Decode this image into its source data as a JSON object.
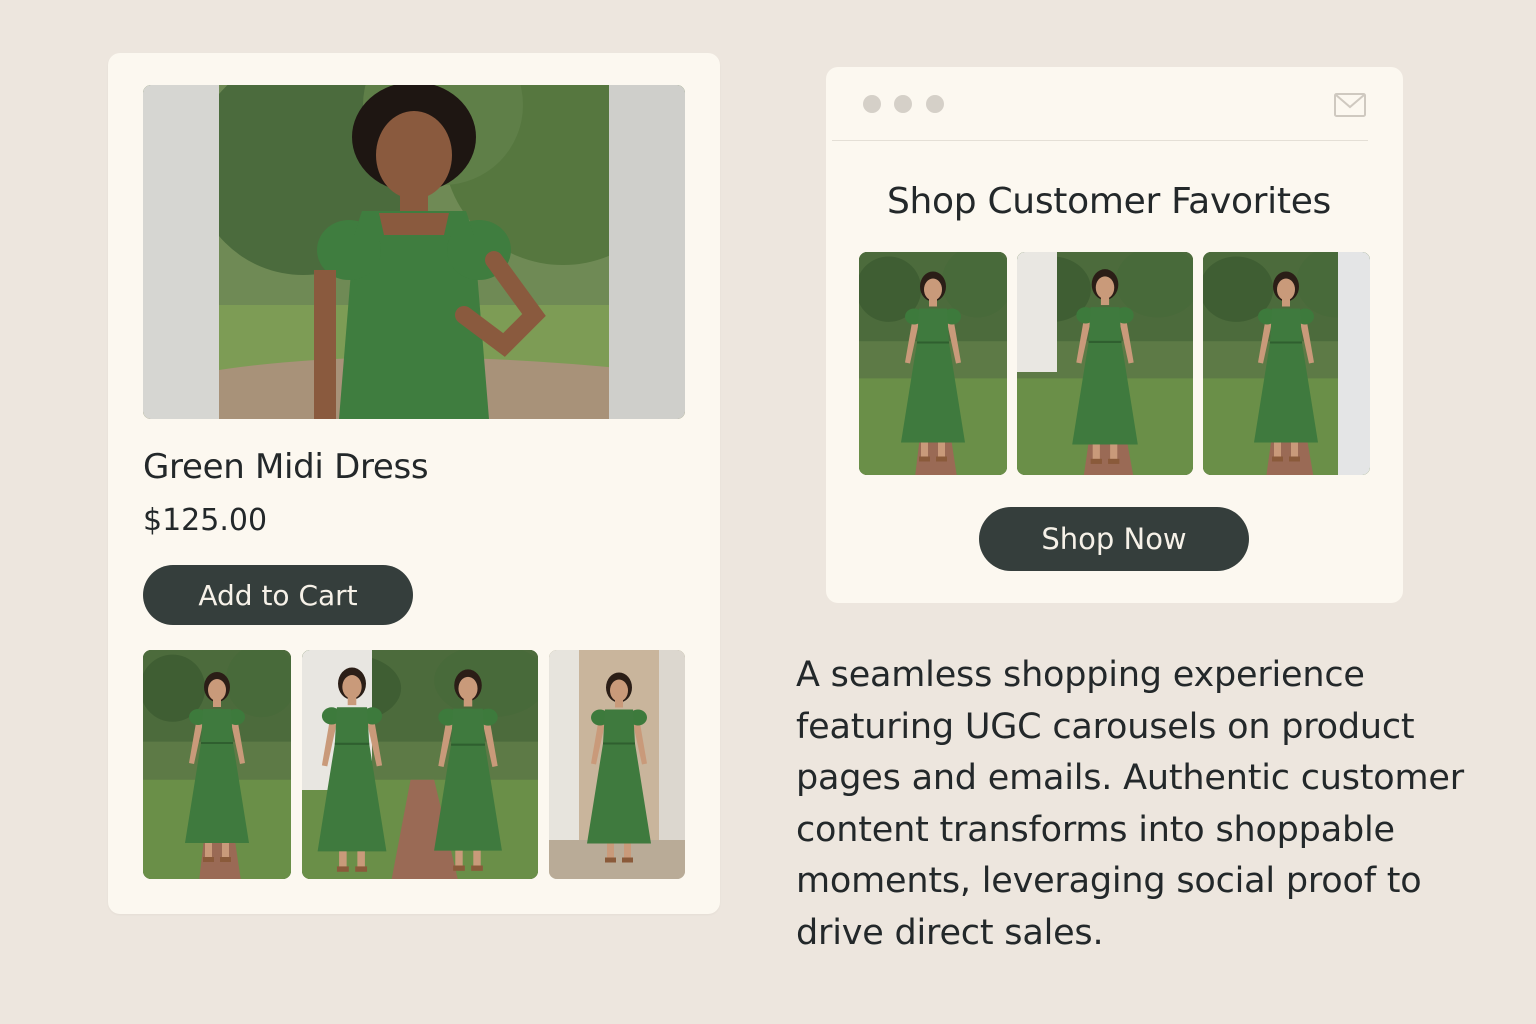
{
  "product_page": {
    "hero_image": {
      "icon": "model-photo-green-dress",
      "description_hidden": true
    },
    "title": "Green Midi Dress",
    "price": "$125.00",
    "add_to_cart_label": "Add to Cart",
    "ugc_gallery_count": 3
  },
  "email": {
    "window_controls": [
      "dot",
      "dot",
      "dot"
    ],
    "mail_icon": "envelope-icon",
    "heading": "Shop Customer Favorites",
    "ugc_gallery_count": 3,
    "cta_label": "Shop Now"
  },
  "description": "A seamless shopping experience featuring UGC carousels on product pages and emails. Authentic customer content transforms into shoppable moments, leveraging social proof to drive direct sales.",
  "colors": {
    "background": "#ede6de",
    "card": "#fcf8f0",
    "button": "#353e3c",
    "button_text": "#f6f1e8",
    "dress_green": "#3f7a3e",
    "text": "#23282a"
  }
}
